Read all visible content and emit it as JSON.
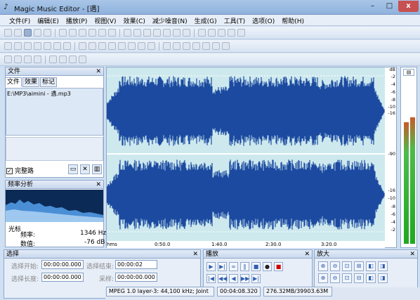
{
  "window": {
    "title": "Magic Music Editor - [遇]",
    "close_glyph": "x",
    "min_glyph": "–",
    "max_glyph": "□"
  },
  "menu": [
    "文件(F)",
    "编辑(E)",
    "播放(P)",
    "视图(V)",
    "效果(C)",
    "减少噪音(N)",
    "生成(G)",
    "工具(T)",
    "选项(O)",
    "帮助(H)"
  ],
  "file_panel": {
    "title": "文件",
    "tabs": [
      "文件",
      "效果",
      "标记"
    ],
    "active_tab": 0,
    "files": [
      "E:\\MP3\\aimini - 遇.mp3"
    ],
    "full_path_label": "完整路",
    "checked": true
  },
  "freq_panel": {
    "title": "频率分析",
    "cursor_label": "光标",
    "freq_label": "频率:",
    "freq_value": "1346 Hz",
    "value_label": "数值:",
    "value_value": "-76 dB"
  },
  "waveform": {
    "db_unit": "dB",
    "db_ticks": [
      "-2",
      "-4",
      "-6",
      "-8",
      "-10",
      "-16",
      "-90",
      "-16",
      "-10",
      "-8",
      "-6",
      "-4",
      "-2"
    ],
    "time_ticks": [
      "hms",
      "0:50.0",
      "1:40.0",
      "2:30.0",
      "3:20.0"
    ],
    "color": "#1c4aa0",
    "bg": "#cde9ee"
  },
  "meter": {
    "left_level": 0.72,
    "right_level": 0.75,
    "color": "#1fa81f"
  },
  "selection": {
    "title": "选择",
    "start_label": "选择开始:",
    "start_value": "00:00:00.000",
    "end_label": "选择结束:",
    "end_value": "00:00:02",
    "length_label": "选择长度:",
    "length_value": "00:00:00.000",
    "end2_label": "采样:",
    "end2_value": "00:00:00.000"
  },
  "play": {
    "title": "播放"
  },
  "zoom": {
    "title": "放大"
  },
  "status": {
    "format": "MPEG 1.0 layer-3: 44,100 kHz; Joint",
    "duration": "00:04:08.320",
    "size": "276.32MB/39903.63M"
  }
}
